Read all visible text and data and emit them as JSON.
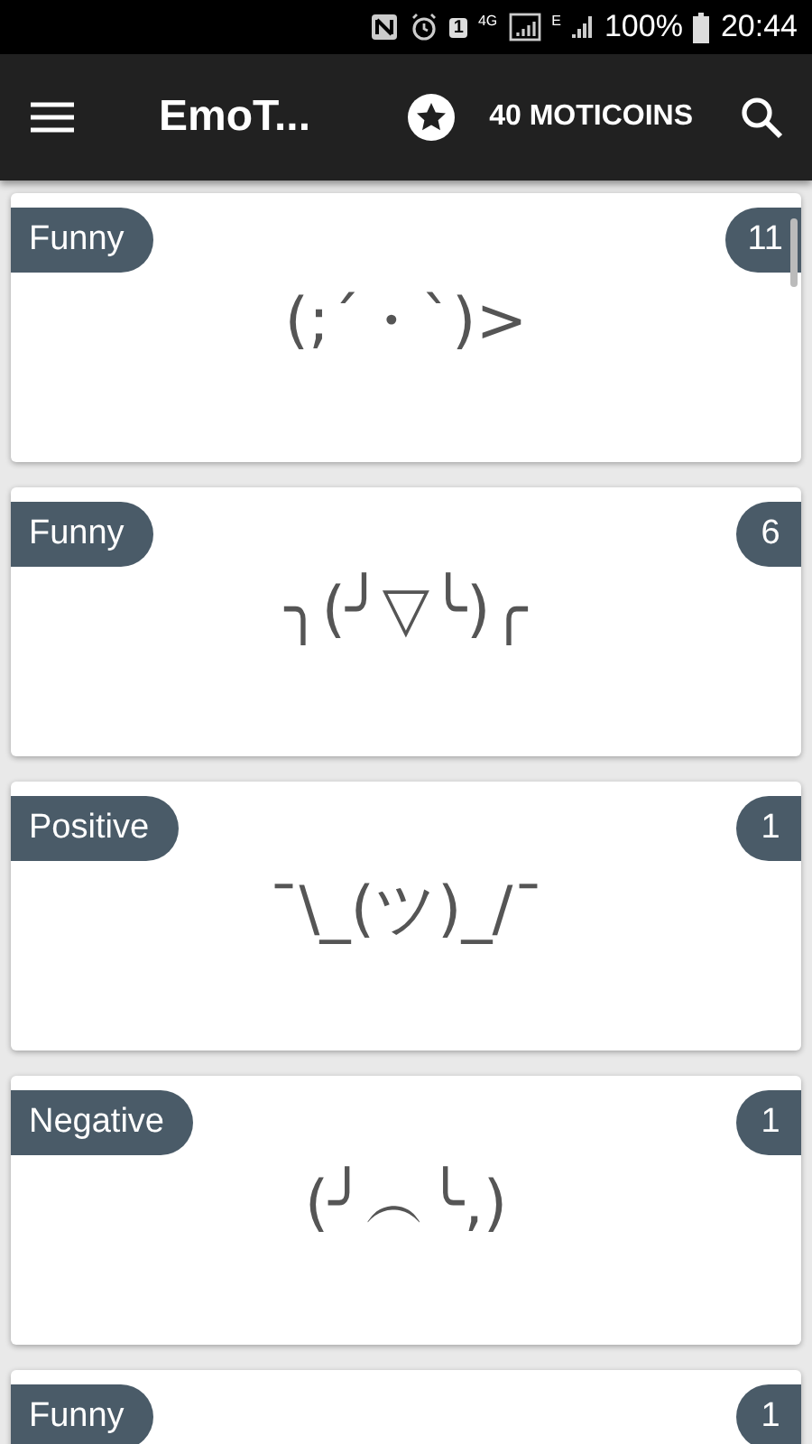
{
  "status_bar": {
    "battery": "100%",
    "time": "20:44",
    "network": "4G",
    "network_2": "E",
    "sim": "1"
  },
  "app_bar": {
    "title": "EmoT...",
    "coins": "40 MOTICOINS"
  },
  "cards": [
    {
      "category": "Funny",
      "count": "11",
      "emoticon": "(;´・`)>"
    },
    {
      "category": "Funny",
      "count": "6",
      "emoticon": "╮(╯▽╰)╭"
    },
    {
      "category": "Positive",
      "count": "1",
      "emoticon": "¯\\_(ツ)_/¯"
    },
    {
      "category": "Negative",
      "count": "1",
      "emoticon": "(╯︵╰,)"
    },
    {
      "category": "Funny",
      "count": "1"
    }
  ]
}
